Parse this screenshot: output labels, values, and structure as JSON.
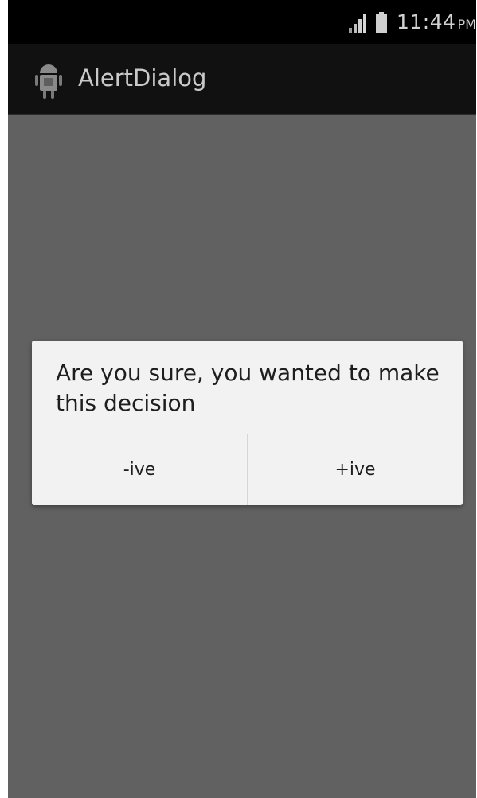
{
  "status_bar": {
    "time": "11:44",
    "ampm": "PM",
    "icons": [
      "signal-icon",
      "battery-icon"
    ]
  },
  "action_bar": {
    "title": "AlertDialog",
    "icon": "android-app-icon"
  },
  "dialog": {
    "message": "Are you sure, you wanted to make this decision",
    "negative_label": "-ive",
    "positive_label": "+ive"
  },
  "colors": {
    "background_dim": "#616161",
    "status_bar": "#000000",
    "action_bar": "#111111",
    "dialog": "#f2f2f2"
  }
}
